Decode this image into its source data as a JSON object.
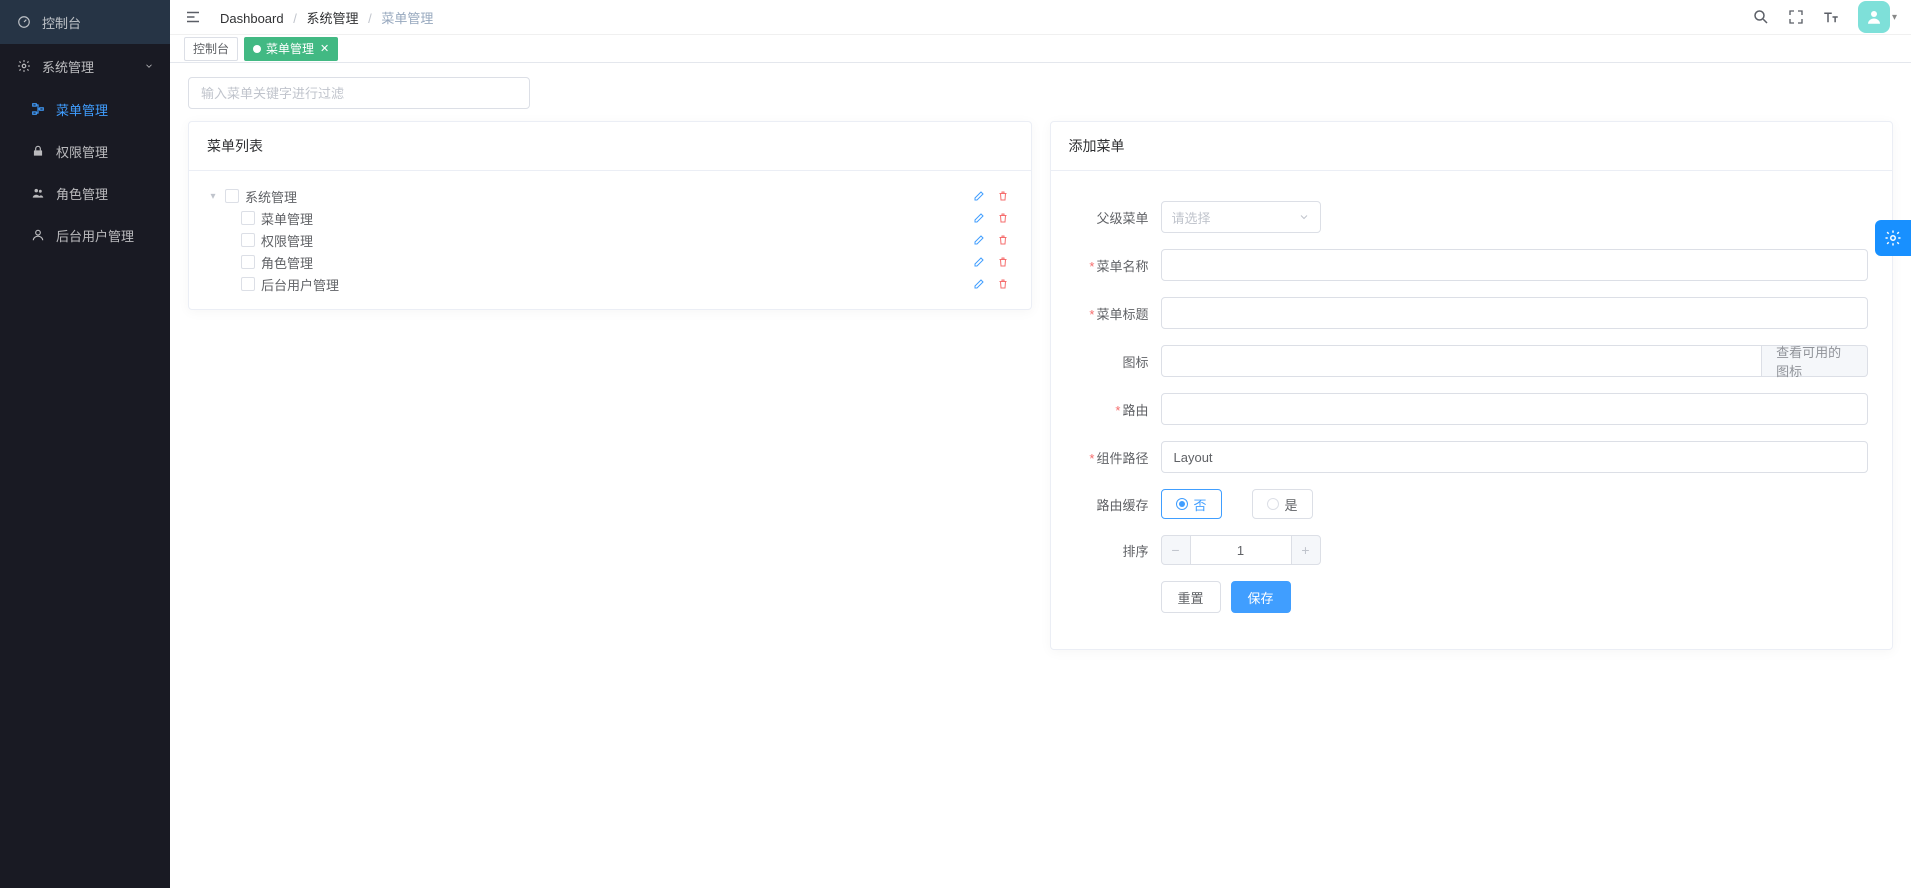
{
  "sidebar": {
    "items": [
      {
        "label": "控制台",
        "icon": "dashboard-icon"
      },
      {
        "label": "系统管理",
        "icon": "gear-icon",
        "expanded": true,
        "children": [
          {
            "label": "菜单管理",
            "icon": "tree-icon",
            "active": true
          },
          {
            "label": "权限管理",
            "icon": "lock-icon"
          },
          {
            "label": "角色管理",
            "icon": "users-icon"
          },
          {
            "label": "后台用户管理",
            "icon": "user-icon"
          }
        ]
      }
    ]
  },
  "breadcrumb": [
    "Dashboard",
    "系统管理",
    "菜单管理"
  ],
  "tabs": [
    {
      "label": "控制台",
      "active": false
    },
    {
      "label": "菜单管理",
      "active": true,
      "closable": true
    }
  ],
  "filter": {
    "placeholder": "输入菜单关键字进行过滤"
  },
  "menuList": {
    "title": "菜单列表",
    "tree": [
      {
        "label": "系统管理",
        "expanded": true,
        "children": [
          {
            "label": "菜单管理"
          },
          {
            "label": "权限管理"
          },
          {
            "label": "角色管理"
          },
          {
            "label": "后台用户管理"
          }
        ]
      }
    ]
  },
  "form": {
    "title": "添加菜单",
    "parent": {
      "label": "父级菜单",
      "placeholder": "请选择"
    },
    "name": {
      "label": "菜单名称",
      "required": true,
      "value": ""
    },
    "titleF": {
      "label": "菜单标题",
      "required": true,
      "value": ""
    },
    "icon": {
      "label": "图标",
      "value": "",
      "append": "查看可用的图标"
    },
    "route": {
      "label": "路由",
      "required": true,
      "value": ""
    },
    "component": {
      "label": "组件路径",
      "required": true,
      "value": "Layout"
    },
    "cache": {
      "label": "路由缓存",
      "options": [
        "否",
        "是"
      ],
      "value": "否"
    },
    "sort": {
      "label": "排序",
      "value": 1
    },
    "buttons": {
      "reset": "重置",
      "save": "保存"
    }
  }
}
